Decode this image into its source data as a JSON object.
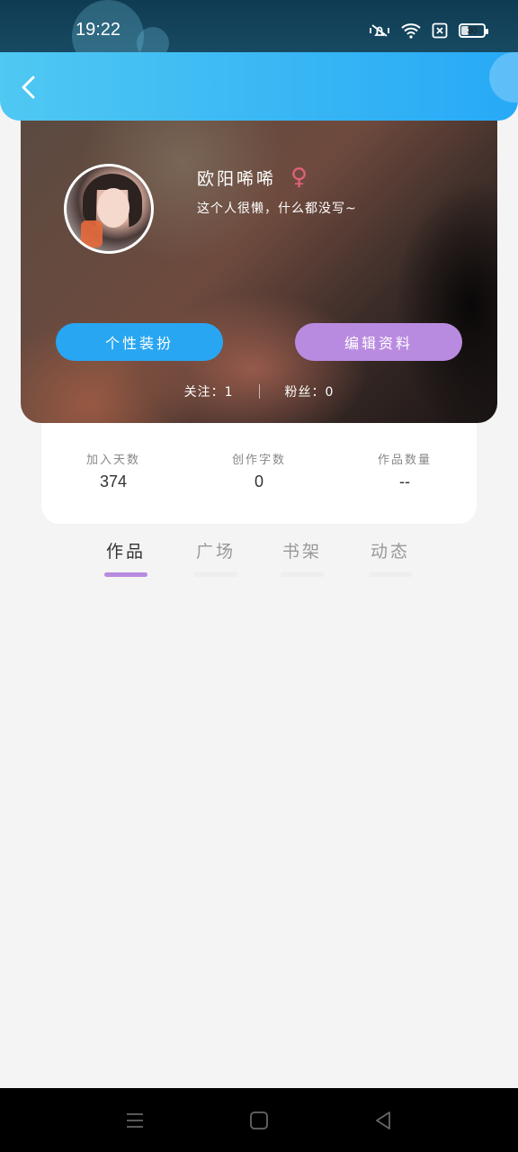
{
  "status": {
    "time": "19:22",
    "battery": "30"
  },
  "profile": {
    "name": "欧阳唏唏",
    "gender_symbol": "♀",
    "bio": "这个人很懒，什么都没写~",
    "dress_button": "个性装扮",
    "edit_button": "编辑资料",
    "follow_label": "关注：1",
    "fans_label": "粉丝：0"
  },
  "stats": [
    {
      "label": "加入天数",
      "value": "374"
    },
    {
      "label": "创作字数",
      "value": "0"
    },
    {
      "label": "作品数量",
      "value": "--"
    }
  ],
  "tabs": [
    {
      "label": "作品"
    },
    {
      "label": "广场"
    },
    {
      "label": "书架"
    },
    {
      "label": "动态"
    }
  ],
  "colors": {
    "accent_blue": "#28a6f2",
    "accent_purple": "#b98be0",
    "gender_pink": "#e0607c"
  }
}
